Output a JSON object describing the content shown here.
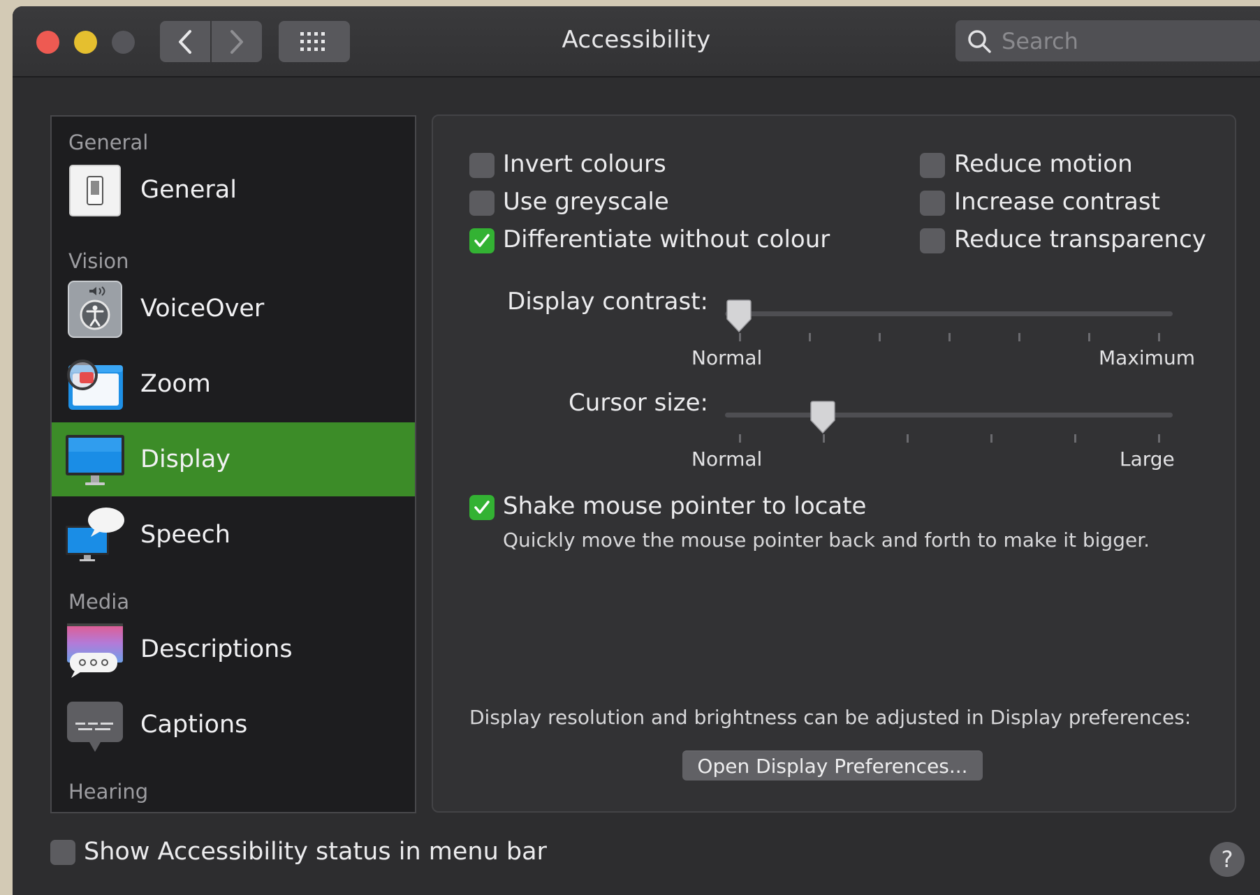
{
  "window": {
    "title": "Accessibility"
  },
  "search": {
    "placeholder": "Search"
  },
  "sidebar": {
    "sections": [
      "General",
      "Vision",
      "Media",
      "Hearing"
    ],
    "items": [
      {
        "label": "General",
        "icon": "switch-icon"
      },
      {
        "label": "VoiceOver",
        "icon": "voiceover-icon"
      },
      {
        "label": "Zoom",
        "icon": "zoom-icon"
      },
      {
        "label": "Display",
        "icon": "display-icon",
        "selected": true
      },
      {
        "label": "Speech",
        "icon": "speech-icon"
      },
      {
        "label": "Descriptions",
        "icon": "descriptions-icon"
      },
      {
        "label": "Captions",
        "icon": "captions-icon"
      }
    ]
  },
  "display": {
    "options_left": [
      {
        "label": "Invert colours",
        "checked": false
      },
      {
        "label": "Use greyscale",
        "checked": false
      },
      {
        "label": "Differentiate without colour",
        "checked": true
      }
    ],
    "options_right": [
      {
        "label": "Reduce motion",
        "checked": false
      },
      {
        "label": "Increase contrast",
        "checked": false
      },
      {
        "label": "Reduce transparency",
        "checked": false
      }
    ],
    "contrast": {
      "label": "Display contrast:",
      "min_label": "Normal",
      "max_label": "Maximum",
      "value": 0
    },
    "cursor": {
      "label": "Cursor size:",
      "min_label": "Normal",
      "max_label": "Large",
      "value": 0.2
    },
    "shake": {
      "label": "Shake mouse pointer to locate",
      "checked": true,
      "description": "Quickly move the mouse pointer back and forth to make it bigger."
    },
    "resolution_note": "Display resolution and brightness can be adjusted in Display preferences:",
    "open_button": "Open Display Preferences..."
  },
  "footer": {
    "status_label": "Show Accessibility status in menu bar",
    "status_checked": false,
    "help": "?"
  },
  "colors": {
    "accent_selected": "#3c8c28",
    "checkbox_on": "#33b233"
  }
}
